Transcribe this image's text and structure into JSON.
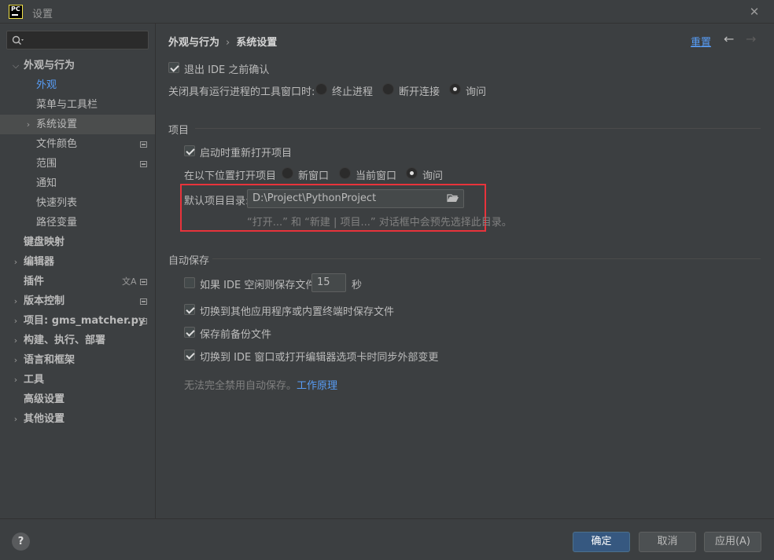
{
  "window": {
    "logo_text": "PC",
    "title": "设置",
    "close_symbol": "✕"
  },
  "sidebar": {
    "search_placeholder": "",
    "items": [
      {
        "label": "外观与行为"
      },
      {
        "label": "外观"
      },
      {
        "label": "菜单与工具栏"
      },
      {
        "label": "系统设置"
      },
      {
        "label": "文件颜色"
      },
      {
        "label": "范围"
      },
      {
        "label": "通知"
      },
      {
        "label": "快速列表"
      },
      {
        "label": "路径变量"
      },
      {
        "label": "键盘映射"
      },
      {
        "label": "编辑器"
      },
      {
        "label": "插件"
      },
      {
        "label": "版本控制"
      },
      {
        "label": "项目: gms_matcher.py"
      },
      {
        "label": "构建、执行、部署"
      },
      {
        "label": "语言和框架"
      },
      {
        "label": "工具"
      },
      {
        "label": "高级设置"
      },
      {
        "label": "其他设置"
      }
    ]
  },
  "header": {
    "breadcrumb_parent": "外观与行为",
    "breadcrumb_sep": "›",
    "breadcrumb_current": "系统设置",
    "reset": "重置"
  },
  "general": {
    "confirm_exit": "退出 IDE 之前确认",
    "close_tool_window_label": "关闭具有运行进程的工具窗口时:",
    "opt_terminate": "终止进程",
    "opt_disconnect": "断开连接",
    "opt_ask": "询问"
  },
  "project": {
    "section": "项目",
    "reopen_on_startup": "启动时重新打开项目",
    "open_location_label": "在以下位置打开项目",
    "opt_new_window": "新窗口",
    "opt_current_window": "当前窗口",
    "opt_ask": "询问",
    "default_dir_label": "默认项目目录:",
    "default_dir_value": "D:\\Project\\PythonProject",
    "default_dir_hint": "“打开...” 和 “新建 | 项目...” 对话框中会预先选择此目录。"
  },
  "autosave": {
    "section": "自动保存",
    "idle_save_label": "如果 IDE 空闲则保存文件",
    "idle_seconds": "15",
    "seconds_unit": "秒",
    "switch_app_save": "切换到其他应用程序或内置终端时保存文件",
    "backup_before_save": "保存前备份文件",
    "sync_external": "切换到 IDE 窗口或打开编辑器选项卡时同步外部变更",
    "disable_note": "无法完全禁用自动保存。",
    "how_it_works": "工作原理"
  },
  "footer": {
    "help": "?",
    "ok": "确定",
    "cancel": "取消",
    "apply": "应用(A)"
  },
  "colors": {
    "accent": "#589df6",
    "highlight_border": "#e8333b",
    "primary_button": "#365880"
  }
}
